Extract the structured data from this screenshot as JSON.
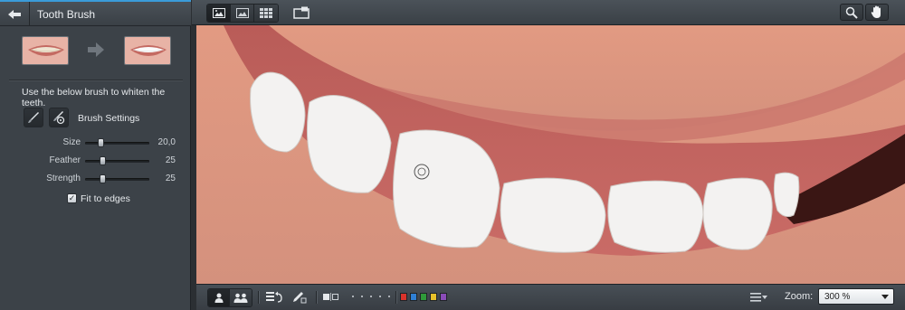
{
  "panel": {
    "title": "Tooth Brush",
    "instruction": "Use the below brush to whiten the teeth.",
    "brush_settings_label": "Brush Settings",
    "sliders": [
      {
        "label": "Size",
        "value": "20,0",
        "level": 0.22
      },
      {
        "label": "Feather",
        "value": "25",
        "level": 0.25
      },
      {
        "label": "Strength",
        "value": "25",
        "level": 0.25
      }
    ],
    "fit_to_edges": {
      "label": "Fit to edges",
      "checked": true
    }
  },
  "toolbar": {
    "view_buttons": [
      "before-after-view-icon",
      "single-view-icon",
      "grid-view-icon"
    ],
    "fit_screen_icon": "fit-screen-icon",
    "zoom_tool_icon": "magnifier-icon",
    "hand_tool_icon": "hand-icon"
  },
  "bottombar": {
    "zoom_label": "Zoom:",
    "zoom_value": "300 %",
    "swatches": [
      "#d9332b",
      "#2f7fd4",
      "#2f9a3a",
      "#e8c22a",
      "#8a4cb8"
    ]
  },
  "colors": {
    "accent": "#3a9bd9",
    "panel_bg": "#3c4248"
  }
}
